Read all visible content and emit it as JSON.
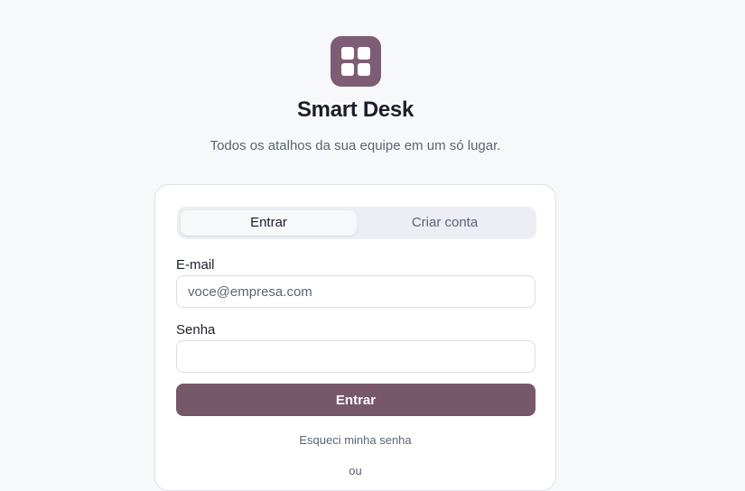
{
  "brand": {
    "icon": "grid-icon",
    "icon_color": "#7d5d74",
    "title": "Smart Desk",
    "subtitle": "Todos os atalhos da sua equipe em um só lugar."
  },
  "auth": {
    "tabs": [
      {
        "label": "Entrar",
        "active": true
      },
      {
        "label": "Criar conta",
        "active": false
      }
    ],
    "email": {
      "label": "E-mail",
      "placeholder": "voce@empresa.com",
      "value": ""
    },
    "password": {
      "label": "Senha",
      "placeholder": "",
      "value": ""
    },
    "submit_label": "Entrar",
    "forgot_label": "Esqueci minha senha",
    "cut_off_text": "ou"
  },
  "colors": {
    "accent": "#775868",
    "background": "#f7f8fa"
  }
}
